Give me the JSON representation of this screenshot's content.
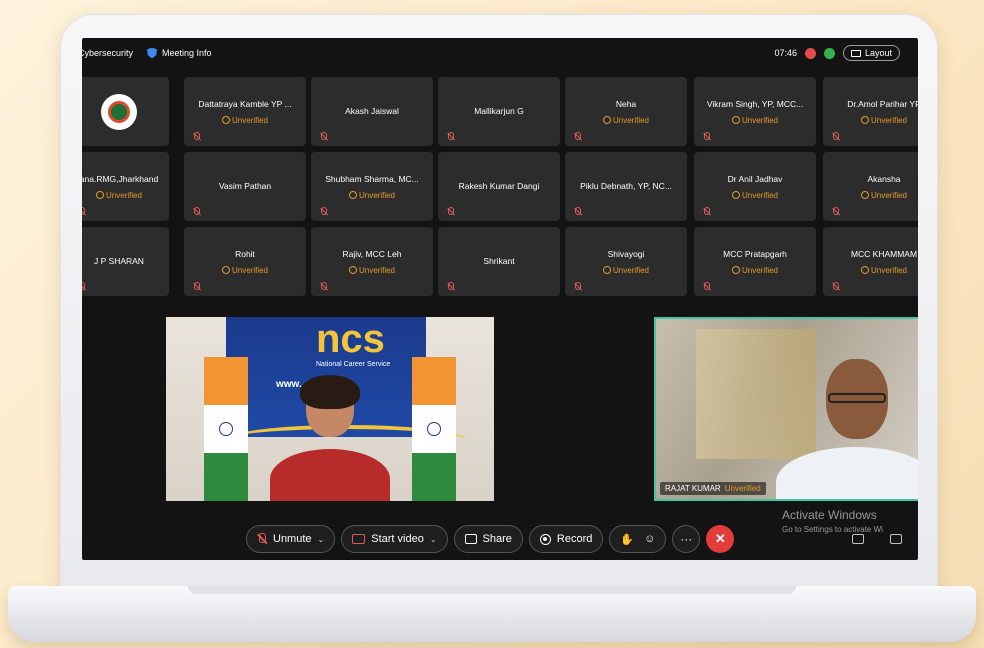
{
  "topbar": {
    "app_title": "Cybersecurity",
    "meeting_info": "Meeting Info",
    "time": "07:46",
    "layout_label": "Layout"
  },
  "tiles": [
    {
      "name": "",
      "status": "",
      "logo": true
    },
    {
      "name": "Dattatraya Kamble YP ...",
      "status": "Unverified"
    },
    {
      "name": "Akash Jaiswal",
      "status": ""
    },
    {
      "name": "Mallikarjun G",
      "status": ""
    },
    {
      "name": "Neha",
      "status": "Unverified"
    },
    {
      "name": "Vikram Singh, YP, MCC...",
      "status": "Unverified"
    },
    {
      "name": "Dr.Amol Parihar YP",
      "status": "Unverified"
    },
    {
      "name": "ana.RMG,Jharkhand",
      "status": "Unverified"
    },
    {
      "name": "Vasim Pathan",
      "status": ""
    },
    {
      "name": "Shubham Sharma, MC...",
      "status": "Unverified"
    },
    {
      "name": "Rakesh Kumar Dangi",
      "status": ""
    },
    {
      "name": "Piklu Debnath, YP, NC...",
      "status": ""
    },
    {
      "name": "Dr Anil Jadhav",
      "status": "Unverified"
    },
    {
      "name": "Akansha",
      "status": "Unverified"
    },
    {
      "name": "J P SHARAN",
      "status": ""
    },
    {
      "name": "Rohit",
      "status": "Unverified"
    },
    {
      "name": "Rajiv, MCC Leh",
      "status": "Unverified"
    },
    {
      "name": "Shrikant",
      "status": ""
    },
    {
      "name": "Shivayogi",
      "status": "Unverified"
    },
    {
      "name": "MCC Pratapgarh",
      "status": "Unverified"
    },
    {
      "name": "MCC KHAMMAM",
      "status": "Unverified"
    }
  ],
  "video_left": {
    "banner_title": "ncs",
    "banner_sub": "National Career Service",
    "banner_url": "www."
  },
  "video_right": {
    "name": "RAJAT KUMAR",
    "status": "Unverified"
  },
  "watermark": {
    "line1": "Activate Windows",
    "line2": "Go to Settings to activate Wi"
  },
  "controls": {
    "unmute": "Unmute",
    "start_video": "Start video",
    "share": "Share",
    "record": "Record",
    "more": "···",
    "end": "✕"
  },
  "colors": {
    "unverified": "#e39a2b",
    "end_call": "#e23b3b",
    "active_border": "#3fc6a8"
  }
}
